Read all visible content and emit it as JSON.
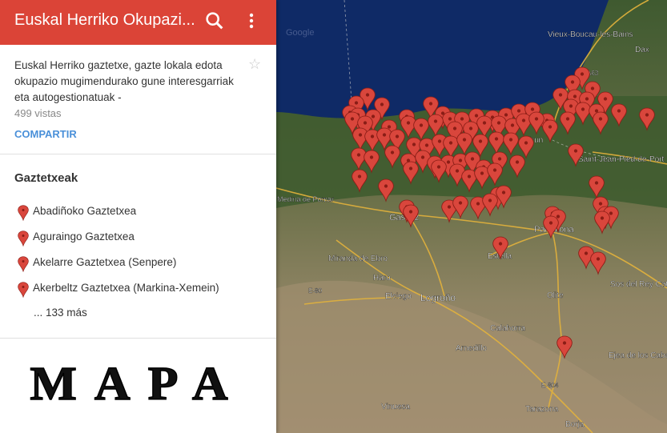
{
  "header": {
    "title": "Euskal Herriko Okupazi...",
    "search_icon": "search-icon",
    "more_icon": "more-vert-icon",
    "bar_color": "#db4437"
  },
  "info": {
    "description": "Euskal Herriko gaztetxe, gazte lokala edota okupazio mugimendurako gune interesgarriak eta autogestionatuak -",
    "views": "499 vistas",
    "share_label": "COMPARTIR",
    "star_icon": "star-outline-icon"
  },
  "layer": {
    "title": "Gaztetxeak",
    "items": [
      {
        "label": "Abadiñoko Gaztetxea"
      },
      {
        "label": "Aguraingo Gaztetxea"
      },
      {
        "label": "Akelarre Gaztetxea (Senpere)"
      },
      {
        "label": "Akerbeltz Gaztetxea (Markina-Xemein)"
      }
    ],
    "more": "... 133 más"
  },
  "banner": {
    "text": "MAPA"
  },
  "map": {
    "marker_color": "#d9463c",
    "places": [
      {
        "name": "Vieux-Boucau-les-Bains"
      },
      {
        "name": "Dax"
      },
      {
        "name": "A63"
      },
      {
        "name": "Irun"
      },
      {
        "name": "Saint-Jean-Pied-de-Port"
      },
      {
        "name": "Medina de Pomar"
      },
      {
        "name": "Gasteiz"
      },
      {
        "name": "Pamplona"
      },
      {
        "name": "Miranda de Ebro"
      },
      {
        "name": "Haro"
      },
      {
        "name": "Estella"
      },
      {
        "name": "E-80"
      },
      {
        "name": "Elciego"
      },
      {
        "name": "Logroño"
      },
      {
        "name": "Olite"
      },
      {
        "name": "Sos del Rey Católico"
      },
      {
        "name": "Calahorra"
      },
      {
        "name": "Arnedillo"
      },
      {
        "name": "Ejea de los Caballeros"
      },
      {
        "name": "E-804"
      },
      {
        "name": "Vinuesa"
      },
      {
        "name": "Tarazona"
      },
      {
        "name": "Borja"
      },
      {
        "name": "Google"
      }
    ]
  }
}
